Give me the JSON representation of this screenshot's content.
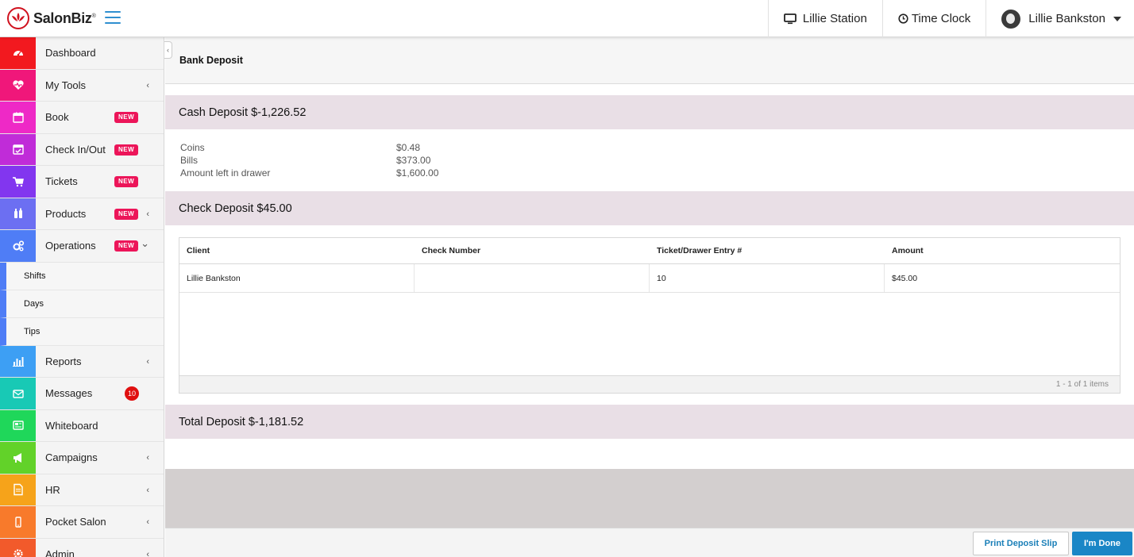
{
  "header": {
    "brand": "SalonBiz",
    "brand_mark": "®",
    "station": "Lillie Station",
    "time_clock": "Time Clock",
    "user": "Lillie Bankston"
  },
  "sidebar": {
    "items": [
      {
        "label": "Dashboard",
        "color": "#f2191f",
        "icon": "dashboard-gauge-icon"
      },
      {
        "label": "My Tools",
        "color": "#f0177a",
        "icon": "heartbeat-icon",
        "chevron": "‹"
      },
      {
        "label": "Book",
        "color": "#ee29c6",
        "icon": "calendar-icon",
        "badge": "NEW"
      },
      {
        "label": "Check In/Out",
        "color": "#c02cd8",
        "icon": "calendar-check-icon",
        "badge": "NEW"
      },
      {
        "label": "Tickets",
        "color": "#8236ef",
        "icon": "shopping-cart-icon",
        "badge": "NEW"
      },
      {
        "label": "Products",
        "color": "#6c6ff2",
        "icon": "bottles-icon",
        "badge": "NEW",
        "chevron": "‹"
      },
      {
        "label": "Operations",
        "color": "#4f7df6",
        "icon": "gears-icon",
        "badge": "NEW",
        "chevron": "⌄"
      },
      {
        "label": "Reports",
        "color": "#3d9ff4",
        "icon": "bar-chart-icon",
        "chevron": "‹"
      },
      {
        "label": "Messages",
        "color": "#18c9b5",
        "icon": "envelope-icon",
        "count": "10"
      },
      {
        "label": "Whiteboard",
        "color": "#1fd75a",
        "icon": "newspaper-icon"
      },
      {
        "label": "Campaigns",
        "color": "#62d229",
        "icon": "megaphone-icon",
        "chevron": "‹"
      },
      {
        "label": "HR",
        "color": "#f6a31a",
        "icon": "document-icon",
        "chevron": "‹"
      },
      {
        "label": "Pocket Salon",
        "color": "#f87a2b",
        "icon": "mobile-icon",
        "chevron": "‹"
      },
      {
        "label": "Admin",
        "color": "#f25a2b",
        "icon": "gear-icon",
        "chevron": "‹"
      }
    ],
    "operations_sub": [
      "Shifts",
      "Days",
      "Tips"
    ]
  },
  "page": {
    "title": "Bank Deposit",
    "cash_deposit": {
      "heading": "Cash Deposit $-1,226.52",
      "lines": [
        {
          "label": "Coins",
          "value": "$0.48"
        },
        {
          "label": "Bills",
          "value": "$373.00"
        },
        {
          "label": "Amount left in drawer",
          "value": "$1,600.00"
        }
      ]
    },
    "check_deposit": {
      "heading": "Check Deposit $45.00",
      "columns": [
        "Client",
        "Check Number",
        "Ticket/Drawer Entry #",
        "Amount"
      ],
      "rows": [
        [
          "Lillie Bankston",
          "",
          "10",
          "$45.00"
        ]
      ],
      "pager": "1 - 1 of 1 items"
    },
    "total_deposit": "Total Deposit $-1,181.52"
  },
  "footer": {
    "print_button": "Print Deposit Slip",
    "done_button": "I'm Done"
  }
}
